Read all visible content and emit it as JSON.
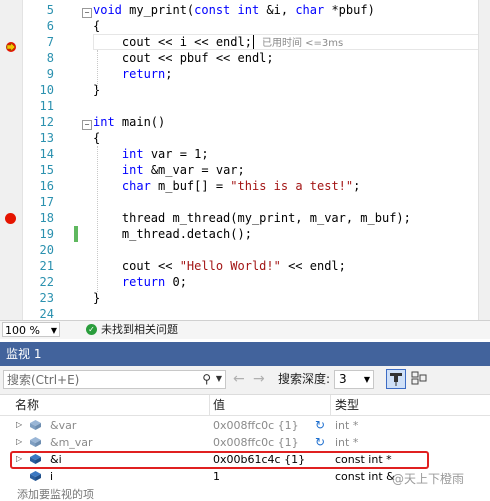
{
  "editor": {
    "lines": [
      {
        "num": "5",
        "code": [
          {
            "t": "void",
            "c": "kw"
          },
          {
            "t": " my_print("
          },
          {
            "t": "const",
            "c": "kw"
          },
          {
            "t": " "
          },
          {
            "t": "int",
            "c": "kw"
          },
          {
            "t": " &i, "
          },
          {
            "t": "char",
            "c": "kw"
          },
          {
            "t": " *pbuf)"
          }
        ]
      },
      {
        "num": "6",
        "code": [
          {
            "t": "{"
          }
        ]
      },
      {
        "num": "7",
        "code": [
          {
            "t": "    cout << i << endl;"
          }
        ],
        "hint": "已用时间 <=3ms"
      },
      {
        "num": "8",
        "code": [
          {
            "t": "    cout << pbuf << endl;"
          }
        ]
      },
      {
        "num": "9",
        "code": [
          {
            "t": "    "
          },
          {
            "t": "return",
            "c": "kw"
          },
          {
            "t": ";"
          }
        ]
      },
      {
        "num": "10",
        "code": [
          {
            "t": "}"
          }
        ]
      },
      {
        "num": "11",
        "code": []
      },
      {
        "num": "12",
        "code": [
          {
            "t": "int",
            "c": "kw"
          },
          {
            "t": " main()"
          }
        ]
      },
      {
        "num": "13",
        "code": [
          {
            "t": "{"
          }
        ]
      },
      {
        "num": "14",
        "code": [
          {
            "t": "    "
          },
          {
            "t": "int",
            "c": "kw"
          },
          {
            "t": " var = 1;"
          }
        ]
      },
      {
        "num": "15",
        "code": [
          {
            "t": "    "
          },
          {
            "t": "int",
            "c": "kw"
          },
          {
            "t": " &m_var = var;"
          }
        ]
      },
      {
        "num": "16",
        "code": [
          {
            "t": "    "
          },
          {
            "t": "char",
            "c": "kw"
          },
          {
            "t": " m_buf[] = "
          },
          {
            "t": "\"this is a test!\"",
            "c": "st"
          },
          {
            "t": ";"
          }
        ]
      },
      {
        "num": "17",
        "code": []
      },
      {
        "num": "18",
        "code": [
          {
            "t": "    thread m_thread(my_print, m_var, m_buf);"
          }
        ]
      },
      {
        "num": "19",
        "code": [
          {
            "t": "    m_thread.detach();"
          }
        ]
      },
      {
        "num": "20",
        "code": []
      },
      {
        "num": "21",
        "code": [
          {
            "t": "    cout << "
          },
          {
            "t": "\"Hello World!\"",
            "c": "st"
          },
          {
            "t": " << endl;"
          }
        ]
      },
      {
        "num": "22",
        "code": [
          {
            "t": "    "
          },
          {
            "t": "return",
            "c": "kw"
          },
          {
            "t": " 0;"
          }
        ]
      },
      {
        "num": "23",
        "code": [
          {
            "t": "}"
          }
        ]
      },
      {
        "num": "24",
        "code": []
      }
    ]
  },
  "status": {
    "zoom": "100 %",
    "message": "未找到相关问题"
  },
  "watch": {
    "title": "监视 1",
    "search_placeholder": "搜索(Ctrl+E)",
    "depth_label": "搜索深度:",
    "depth_value": "3",
    "columns": {
      "name": "名称",
      "value": "值",
      "type": "类型"
    },
    "rows": [
      {
        "name": "&var",
        "value": "0x008ffc0c {1}",
        "type": "int *",
        "stale": true
      },
      {
        "name": "&m_var",
        "value": "0x008ffc0c {1}",
        "type": "int *",
        "stale": true
      },
      {
        "name": "&i",
        "value": "0x00b61c4c {1}",
        "type": "const int *",
        "stale": false
      },
      {
        "name": "i",
        "value": "1",
        "type": "const int &",
        "stale": false
      }
    ],
    "add_hint": "添加要监视的项"
  },
  "watermark": "@天上下橙雨",
  "colors": {
    "accent": "#42639c",
    "breakpoint": "#e51400",
    "highlight": "#e02020"
  }
}
